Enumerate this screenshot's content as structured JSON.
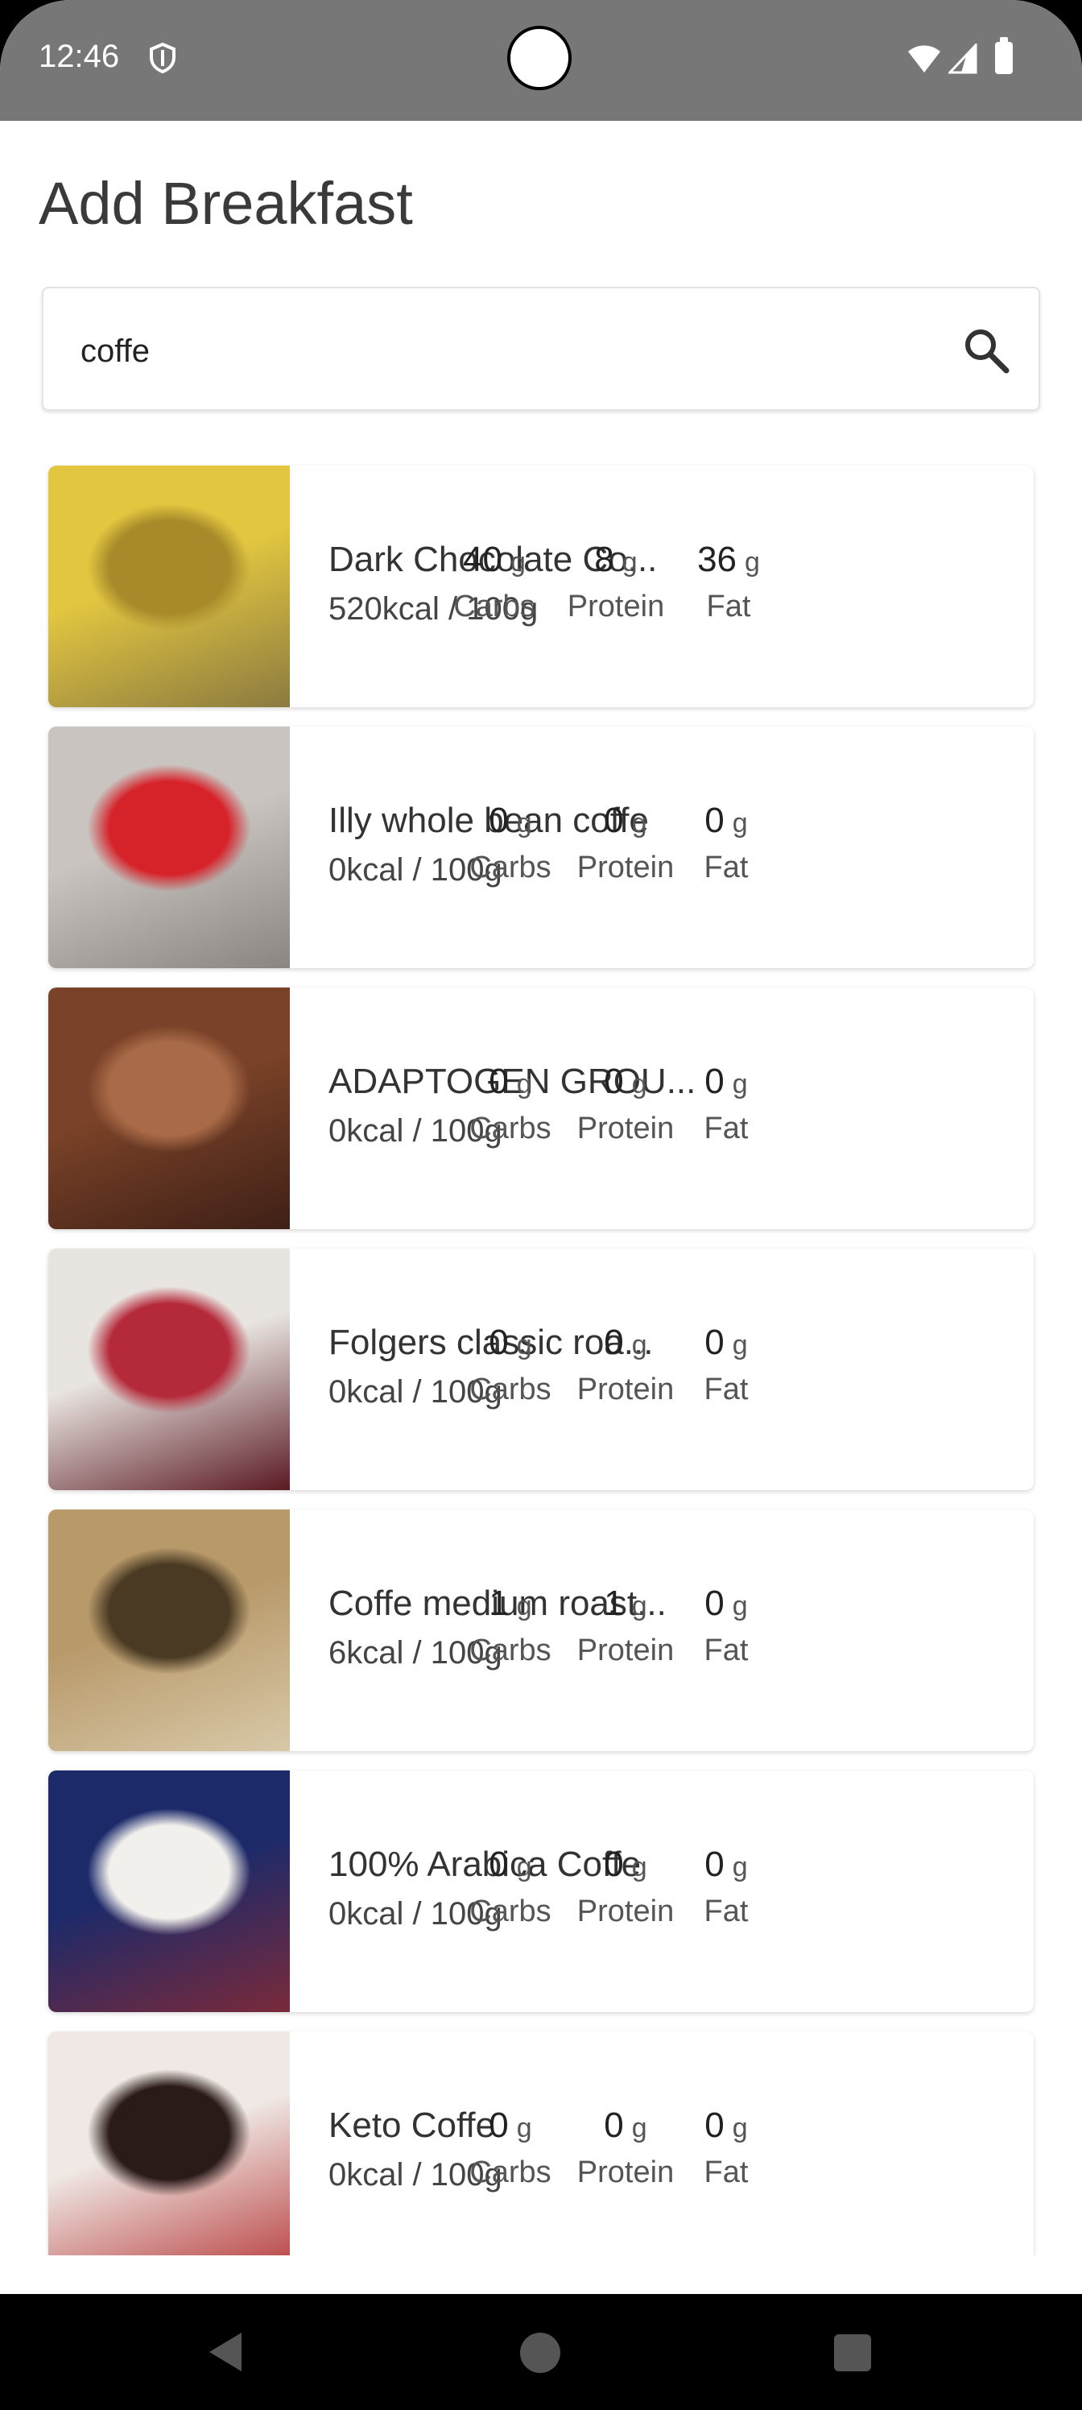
{
  "status_bar": {
    "time": "12:46"
  },
  "page": {
    "title": "Add Breakfast"
  },
  "search": {
    "value": "coffe"
  },
  "results": [
    {
      "name": "Dark Chocolate Co...",
      "kcal": "520kcal / 100g",
      "carbs": "40",
      "protein": "8",
      "fat": "36",
      "image": "dark-chocolate-coffee-buzz-bar-photo",
      "colors": [
        "#e2c640",
        "#a88a2a",
        "#8b7a40"
      ]
    },
    {
      "name": "Illy whole bean coffe",
      "kcal": "0kcal / 100g",
      "carbs": "0",
      "protein": "0",
      "fat": "0",
      "image": "illy-coffee-can-photo",
      "colors": [
        "#c9c4c0",
        "#d6232a",
        "#8a8580"
      ]
    },
    {
      "name": "ADAPTOGEN GROU...",
      "kcal": "0kcal / 100g",
      "carbs": "0",
      "protein": "0",
      "fat": "0",
      "image": "four-sigmatic-coffee-bag-photo",
      "colors": [
        "#7a4228",
        "#a86a48",
        "#3e2016"
      ]
    },
    {
      "name": "Folgers  classic roa...",
      "kcal": "0kcal / 100g",
      "carbs": "0",
      "protein": "0",
      "fat": "0",
      "image": "folgers-classic-roast-jar-photo",
      "colors": [
        "#e8e4e0",
        "#b52a3a",
        "#5a1a22"
      ]
    },
    {
      "name": "Coffe medium roast...",
      "kcal": "6kcal / 100g",
      "carbs": "1",
      "protein": "1",
      "fat": "0",
      "image": "starbucks-coffee-bag-photo",
      "colors": [
        "#b89a6a",
        "#4a3a24",
        "#d8c8a8"
      ]
    },
    {
      "name": "100% Arabica Coffe",
      "kcal": "0kcal / 100g",
      "carbs": "0",
      "protein": "0",
      "fat": "0",
      "image": "alto-grande-coffee-capsules-box-photo",
      "colors": [
        "#1c2a6a",
        "#f2f0ec",
        "#7a2a3a"
      ]
    },
    {
      "name": "Keto Coffe",
      "kcal": "0kcal / 100g",
      "carbs": "0",
      "protein": "0",
      "fat": "0",
      "image": "keto-coffee-package-photo",
      "colors": [
        "#efe8e4",
        "#2a1a18",
        "#b84040"
      ]
    }
  ],
  "labels": {
    "carbs": "Carbs",
    "protein": "Protein",
    "fat": "Fat",
    "unit": "g"
  },
  "icons": {
    "search": "search-icon",
    "shield": "shield-icon",
    "back": "back-icon",
    "home": "home-icon",
    "recents": "recents-icon"
  }
}
